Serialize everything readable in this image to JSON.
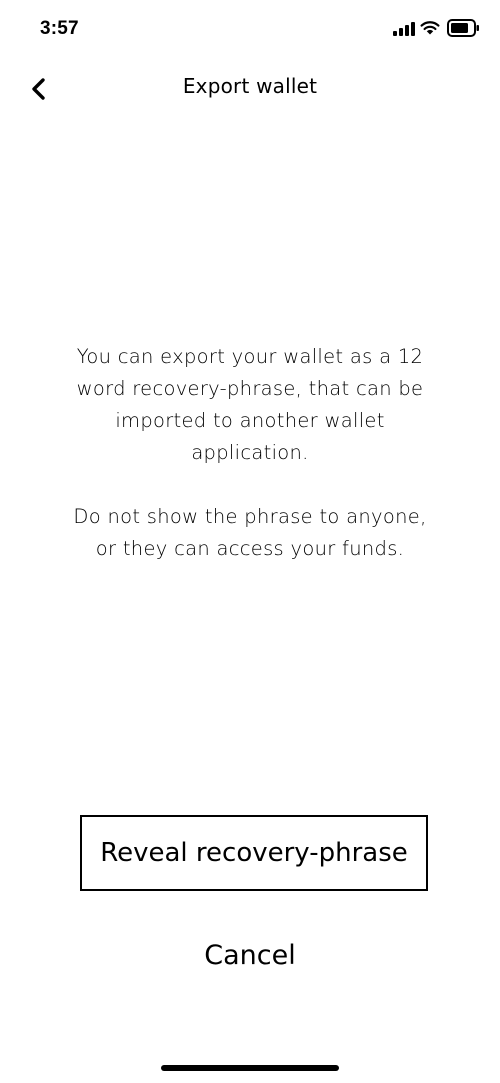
{
  "status_bar": {
    "time": "3:57",
    "icons": [
      "cellular-signal-icon",
      "wifi-icon",
      "battery-icon"
    ]
  },
  "nav": {
    "back_icon": "chevron-left-icon",
    "title": "Export wallet"
  },
  "content": {
    "paragraph_1": "You can export your wallet as a 12 word recovery-phrase, that can be imported to another wallet application.",
    "paragraph_2": "Do not show the phrase to anyone, or they can access your funds."
  },
  "actions": {
    "reveal_label": "Reveal recovery-phrase",
    "cancel_label": "Cancel"
  }
}
